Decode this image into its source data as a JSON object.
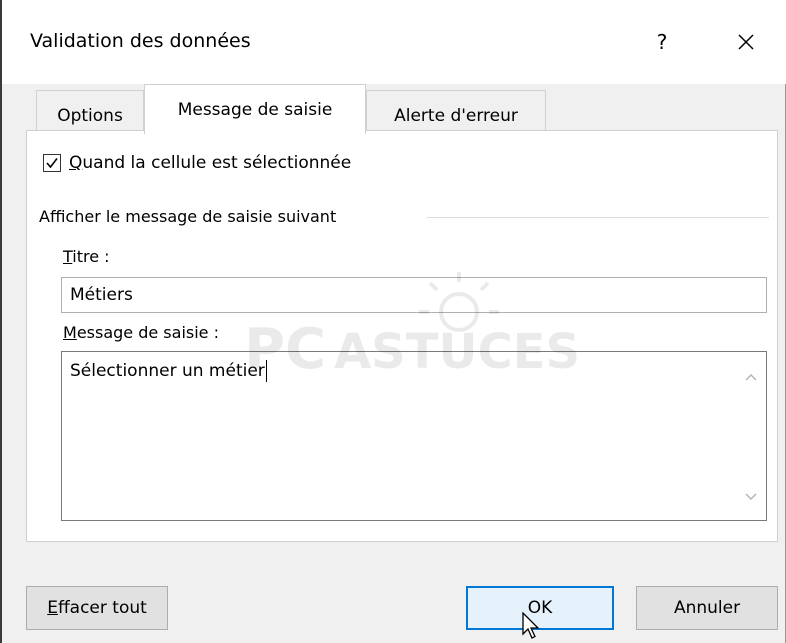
{
  "window": {
    "title": "Validation des données",
    "help_label": "?"
  },
  "tabs": [
    {
      "label": "Options",
      "active": false
    },
    {
      "label": "Message de saisie",
      "active": true
    },
    {
      "label": "Alerte d'erreur",
      "active": false
    }
  ],
  "checkbox": {
    "checked": true,
    "label_first": "Q",
    "label_rest": "uand la cellule est sélectionnée"
  },
  "group": {
    "label": "Afficher le message de saisie suivant"
  },
  "titre": {
    "label_first": "T",
    "label_rest": "itre :",
    "value": "Métiers"
  },
  "message": {
    "label_first": "M",
    "label_rest": "essage de saisie :",
    "value": "Sélectionner un métier"
  },
  "watermark": {
    "logo_text": "ASTUCES",
    "logo_prefix": "PC"
  },
  "buttons": {
    "clear_first": "E",
    "clear_rest": "ffacer tout",
    "ok": "OK",
    "cancel": "Annuler"
  },
  "colors": {
    "accent": "#0078d7",
    "dialog_bg": "#f0f0f0"
  }
}
